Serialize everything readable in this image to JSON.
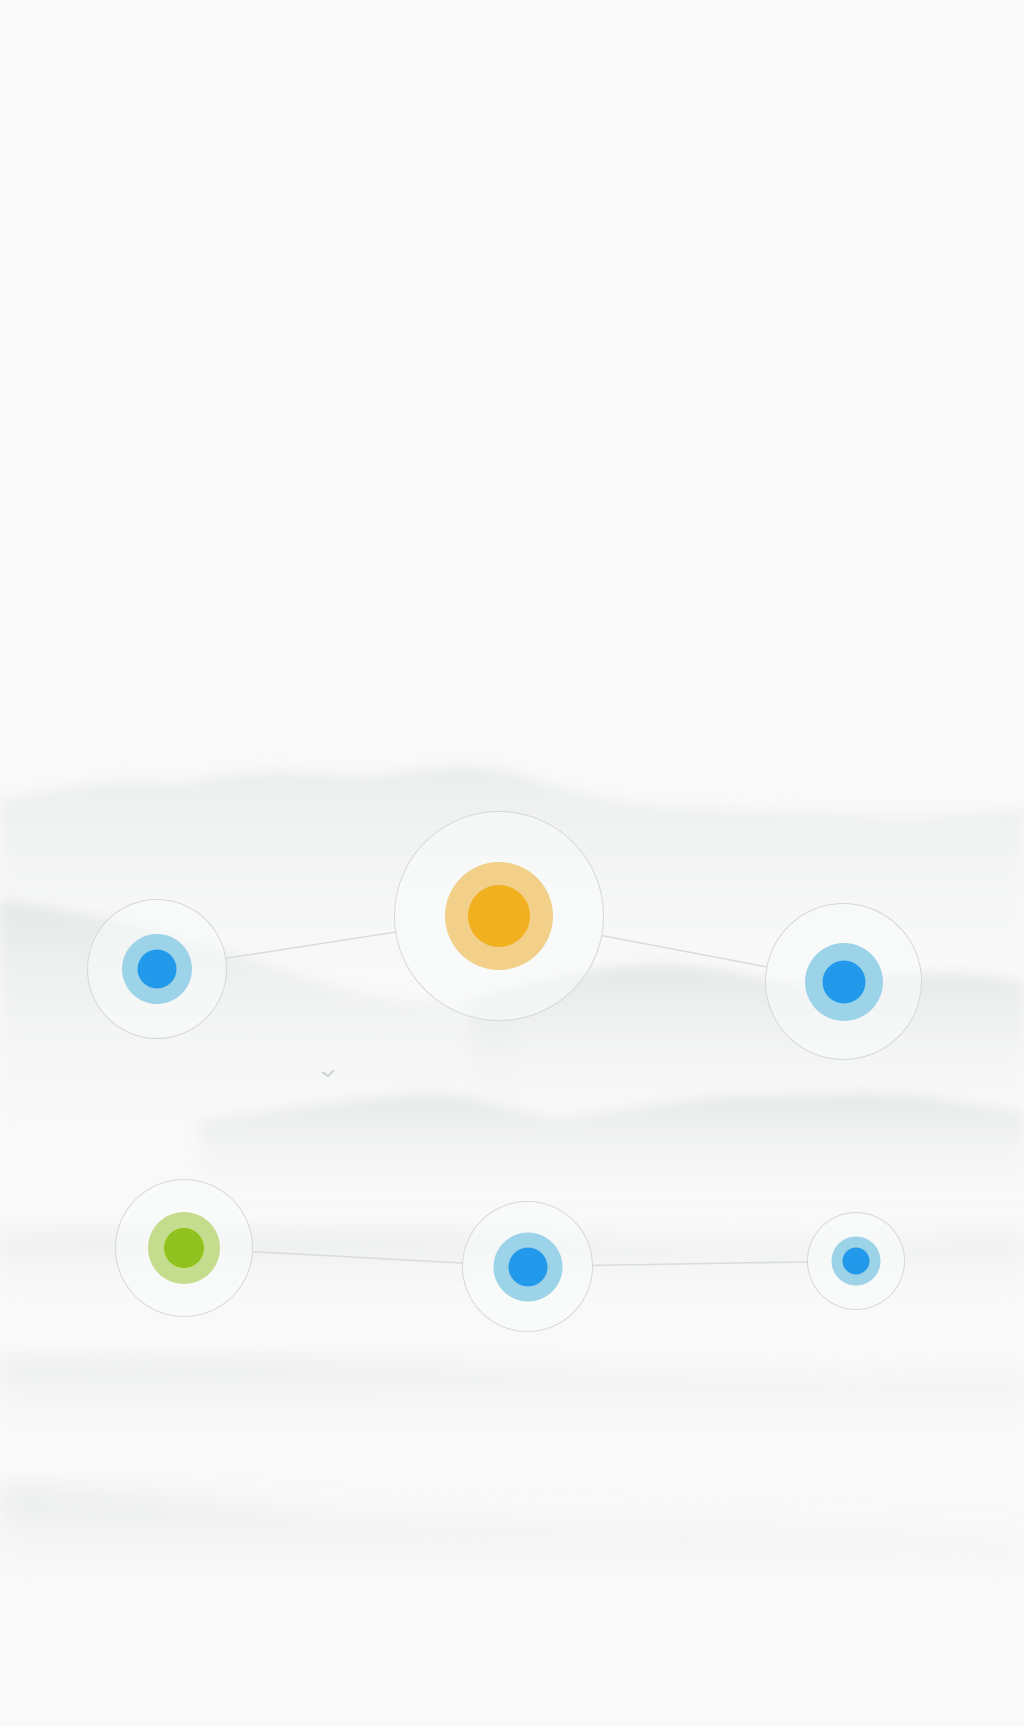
{
  "nodes": [
    {
      "id": "node-1",
      "halo_color": "#9dd3e8",
      "dot_color": "#2399ec"
    },
    {
      "id": "node-2",
      "halo_color": "#f3d08a",
      "dot_color": "#f0b020"
    },
    {
      "id": "node-3",
      "halo_color": "#9dd3e8",
      "dot_color": "#2399ec"
    },
    {
      "id": "node-4",
      "halo_color": "#c5dc8e",
      "dot_color": "#8fc21f"
    },
    {
      "id": "node-5",
      "halo_color": "#9dd3e8",
      "dot_color": "#2399ec"
    },
    {
      "id": "node-6",
      "halo_color": "#9dd3e8",
      "dot_color": "#2399ec"
    }
  ],
  "connections": [
    [
      "node-1",
      "node-2"
    ],
    [
      "node-2",
      "node-3"
    ],
    [
      "node-4",
      "node-5"
    ],
    [
      "node-5",
      "node-6"
    ]
  ],
  "theme": {
    "background": "#f8f9f8",
    "ring_color": "#d6d8d8",
    "line_color": "#dadcdc"
  }
}
